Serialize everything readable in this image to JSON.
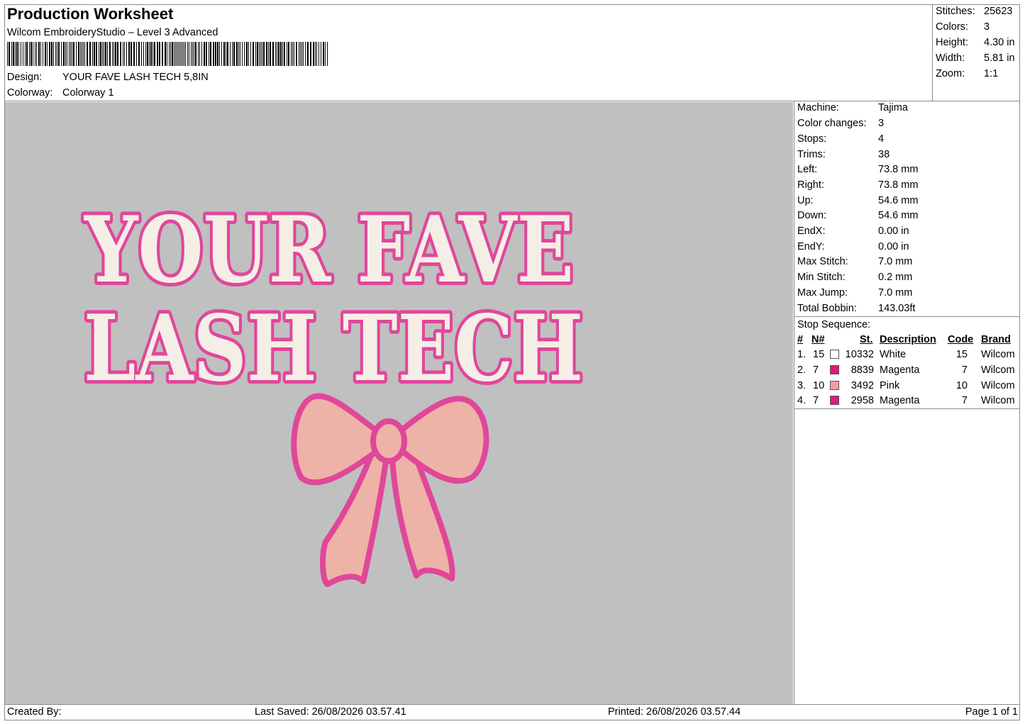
{
  "header": {
    "title": "Production Worksheet",
    "software": "Wilcom EmbroideryStudio – Level 3 Advanced",
    "design_label": "Design:",
    "design_value": "YOUR FAVE LASH TECH 5,8IN",
    "colorway_label": "Colorway:",
    "colorway_value": "Colorway 1"
  },
  "summary": [
    {
      "label": "Stitches:",
      "value": "25623"
    },
    {
      "label": "Colors:",
      "value": "3"
    },
    {
      "label": "Height:",
      "value": "4.30 in"
    },
    {
      "label": "Width:",
      "value": "5.81 in"
    },
    {
      "label": "Zoom:",
      "value": "1:1"
    }
  ],
  "machine_info": [
    {
      "label": "Machine:",
      "value": "Tajima"
    },
    {
      "label": "Color changes:",
      "value": "3"
    },
    {
      "label": "Stops:",
      "value": "4"
    },
    {
      "label": "Trims:",
      "value": "38"
    },
    {
      "label": "Left:",
      "value": "73.8 mm"
    },
    {
      "label": "Right:",
      "value": "73.8 mm"
    },
    {
      "label": "Up:",
      "value": "54.6 mm"
    },
    {
      "label": "Down:",
      "value": "54.6 mm"
    },
    {
      "label": "EndX:",
      "value": "0.00 in"
    },
    {
      "label": "EndY:",
      "value": "0.00 in"
    },
    {
      "label": "Max Stitch:",
      "value": "7.0 mm"
    },
    {
      "label": "Min Stitch:",
      "value": "0.2 mm"
    },
    {
      "label": "Max Jump:",
      "value": "7.0 mm"
    },
    {
      "label": "Total Bobbin:",
      "value": "143.03ft"
    }
  ],
  "stop_sequence": {
    "title": "Stop Sequence:",
    "columns": [
      "#",
      "N#",
      "St.",
      "Description",
      "Code",
      "Brand"
    ],
    "rows": [
      {
        "num": "1.",
        "n": "15",
        "color": "#ffffff",
        "st": "10332",
        "desc": "White",
        "code": "15",
        "brand": "Wilcom"
      },
      {
        "num": "2.",
        "n": "7",
        "color": "#e0197a",
        "st": "8839",
        "desc": "Magenta",
        "code": "7",
        "brand": "Wilcom"
      },
      {
        "num": "3.",
        "n": "10",
        "color": "#f0a0a0",
        "st": "3492",
        "desc": "Pink",
        "code": "10",
        "brand": "Wilcom"
      },
      {
        "num": "4.",
        "n": "7",
        "color": "#e0197a",
        "st": "2958",
        "desc": "Magenta",
        "code": "7",
        "brand": "Wilcom"
      }
    ]
  },
  "design": {
    "line1": "YOUR FAVE",
    "line2": "LASH TECH",
    "text_fill": "#f4eee6",
    "outline": "#e0479a",
    "bow_fill": "#edb3a6",
    "bow_outline": "#e0479a",
    "background": "#c0c0c0"
  },
  "footer": {
    "created_by": "Created By:",
    "last_saved": "Last Saved: 26/08/2026 03.57.41",
    "printed": "Printed: 26/08/2026 03.57.44",
    "page": "Page 1 of 1"
  }
}
